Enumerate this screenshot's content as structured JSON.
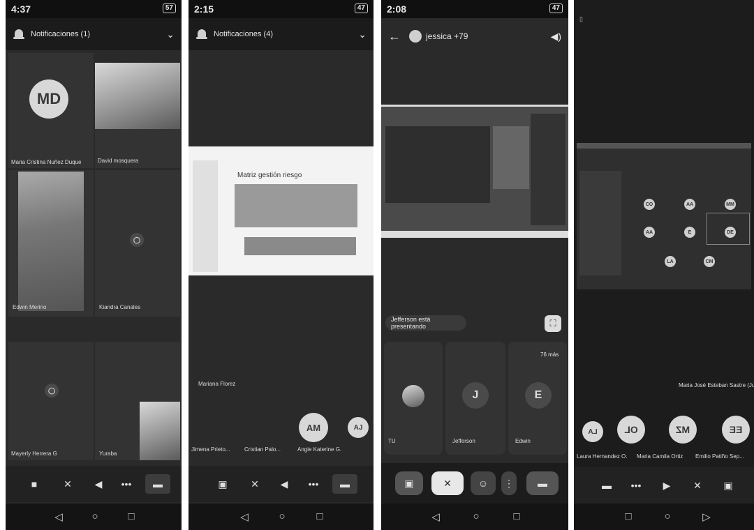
{
  "phone1": {
    "time": "4:37",
    "battery": "57",
    "notifications": "Notificaciones (1)",
    "participants": [
      {
        "initials": "MD",
        "name": "Maria Cristina Nuñez Duque"
      },
      {
        "name": "David mosquera"
      },
      {
        "name": "Edwin Merino"
      },
      {
        "name": "Kiandra Canales"
      },
      {
        "name": "Mayerly Herrera G"
      },
      {
        "name": "Yuraba"
      }
    ]
  },
  "phone2": {
    "time": "2:15",
    "battery": "47",
    "notifications": "Notificaciones (4)",
    "slide_title": "Matriz gestión riesgo",
    "pinned_name": "Mariana Florez",
    "bottom_names": [
      "Jimena Prieto...",
      "Cristian Palo...",
      "Angie Katerine G."
    ],
    "bubbles": [
      "AM",
      "AJ"
    ]
  },
  "phone3": {
    "time": "2:08",
    "battery": "47",
    "call_title": "jessica +79",
    "presenting": "Jefferson está presentando",
    "more": "76 más",
    "tiles": [
      {
        "initial": "",
        "name": "TU"
      },
      {
        "initial": "J",
        "name": "Jefferson"
      },
      {
        "initial": "E",
        "name": "Edwin"
      }
    ]
  },
  "phone4": {
    "status_badge": "▯",
    "presenter": "Maria José Esteban Sastre (Juanita)",
    "bubbles": [
      "LA",
      "OL",
      "MZ",
      "EE"
    ],
    "bubble_names": [
      "Laura Hernandez O.",
      "Maria Camila Ortiz",
      "Emilio Patiño Sep..."
    ],
    "shared_chips": [
      "CO",
      "AA",
      "MM",
      "AA",
      "E",
      "DE",
      "LA",
      "CM"
    ]
  }
}
